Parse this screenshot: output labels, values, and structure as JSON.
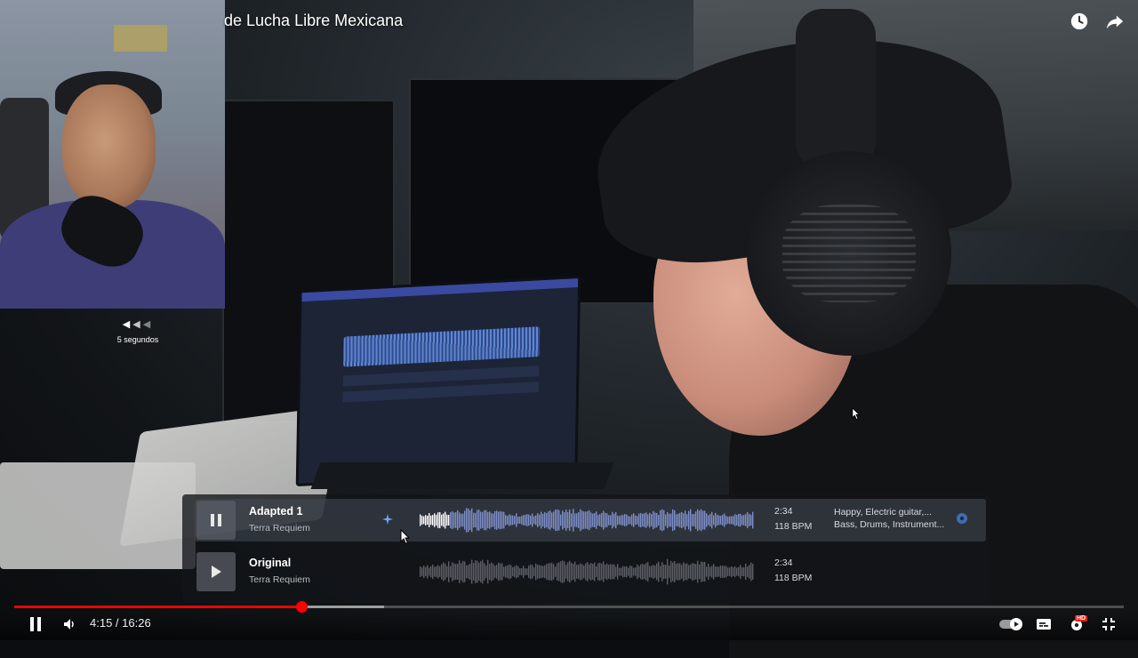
{
  "video": {
    "title": "de Lucha Libre Mexicana"
  },
  "skip_indicator": {
    "label": "5 segundos"
  },
  "tracks": [
    {
      "name": "Adapted 1",
      "artist": "Terra Requiem",
      "duration": "2:34",
      "bpm": "118 BPM",
      "tags_line1": "Happy, Electric guitar,...",
      "tags_line2": "Bass, Drums, Instrument...",
      "state": "playing"
    },
    {
      "name": "Original",
      "artist": "Terra Requiem",
      "duration": "2:34",
      "bpm": "118 BPM",
      "state": "paused"
    }
  ],
  "player": {
    "time_display": "4:15 / 16:26",
    "played_fraction": 0.2586,
    "buffered_fraction": 0.333,
    "hd_badge": "HD",
    "accent_color": "#ff0000"
  },
  "icons": {
    "watch_later": "clock-icon",
    "share": "share-icon",
    "pause": "pause-icon",
    "volume": "volume-icon",
    "autoplay": "autoplay-toggle-icon",
    "subtitles": "subtitles-icon",
    "settings": "gear-icon",
    "fullscreen": "exit-fullscreen-icon"
  }
}
